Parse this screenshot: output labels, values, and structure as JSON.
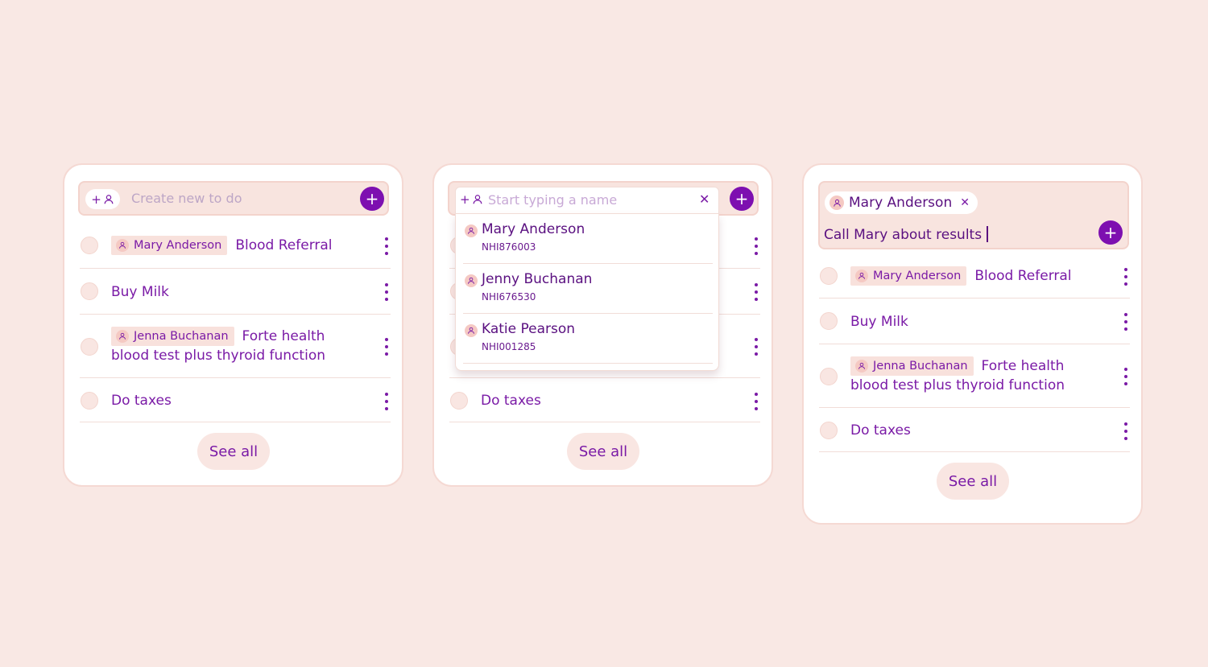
{
  "colors": {
    "background": "#f9e8e4",
    "accent": "#7d0fb0",
    "text": "#7a1aa6",
    "chip_bg": "#f8e1dc"
  },
  "card1": {
    "create_placeholder": "Create new to do",
    "assign_icon": "add-person-icon",
    "todos": [
      {
        "person": "Mary Anderson",
        "text": "Blood Referral"
      },
      {
        "person": "",
        "text": "Buy Milk"
      },
      {
        "person": "Jenna Buchanan",
        "text": "Forte health blood test plus thyroid function"
      },
      {
        "person": "",
        "text": "Do taxes"
      }
    ],
    "see_all": "See all"
  },
  "card2": {
    "search_placeholder": "Start typing a name",
    "suggestions": [
      {
        "name": "Mary Anderson",
        "id": "NHI876003"
      },
      {
        "name": "Jenny Buchanan",
        "id": "NHI676530"
      },
      {
        "name": "Katie Pearson",
        "id": "NHI001285"
      }
    ],
    "todos": [
      {
        "text": "Do taxes"
      }
    ],
    "see_all": "See all"
  },
  "card3": {
    "selected_person": "Mary Anderson",
    "compose_text": "Call Mary about results",
    "todos": [
      {
        "person": "Mary Anderson",
        "text": "Blood Referral"
      },
      {
        "person": "",
        "text": "Buy Milk"
      },
      {
        "person": "Jenna Buchanan",
        "text": "Forte health blood test plus thyroid function"
      },
      {
        "person": "",
        "text": "Do taxes"
      }
    ],
    "see_all": "See all"
  }
}
